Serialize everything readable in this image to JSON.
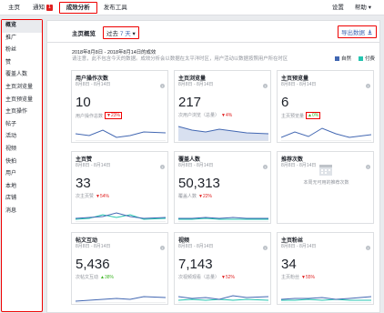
{
  "nav": {
    "tabs": [
      {
        "label": "主页"
      },
      {
        "label": "通知",
        "badge": "1"
      },
      {
        "label": "成效分析"
      },
      {
        "label": "发布工具"
      }
    ],
    "right": [
      {
        "label": "设置"
      },
      {
        "label": "帮助 ▾"
      }
    ]
  },
  "sidebar": {
    "items": [
      {
        "label": "概览"
      },
      {
        "label": "推广"
      },
      {
        "label": "粉丝"
      },
      {
        "label": "赞"
      },
      {
        "label": "覆盖人数"
      },
      {
        "label": "主页浏览量"
      },
      {
        "label": "主页预览量"
      },
      {
        "label": "主页操作"
      },
      {
        "label": "帖子"
      },
      {
        "label": "活动"
      },
      {
        "label": "视频"
      },
      {
        "label": "快拍"
      },
      {
        "label": "用户"
      },
      {
        "label": "本地"
      },
      {
        "label": "店铺"
      },
      {
        "label": "消息"
      }
    ]
  },
  "header": {
    "title": "主页概览",
    "period_prefix": "过去",
    "period_value": "7 天",
    "period_caret": "▾",
    "export_label": "导出数据"
  },
  "daterange": "2018年8月8日 - 2018年8月14日的成效",
  "note": "请注意，此不包含今天的数据。成效分析会以数据在太平洋时区，用户活动以数据按照用户所在时区",
  "legend": [
    {
      "label": "自然",
      "color": "#4267b2"
    },
    {
      "label": "付费",
      "color": "#25c5b0"
    }
  ],
  "cards": [
    {
      "title": "用户操作次数",
      "date": "8月8日 - 8月14日",
      "value": "10",
      "sub": "用户操作总数",
      "change": "▼23%",
      "dir": "down",
      "hl": true
    },
    {
      "title": "主页浏览量",
      "date": "8月8日 - 8月14日",
      "value": "217",
      "sub": "次用户浏览（总量）",
      "change": "▼4%",
      "dir": "down",
      "hl": false
    },
    {
      "title": "主页预览量",
      "date": "8月8日 - 8月14日",
      "value": "6",
      "sub": "主页预览量",
      "change": "▲0%",
      "dir": "up",
      "hl": true
    },
    {
      "title": "主页赞",
      "date": "8月8日 - 8月14日",
      "value": "33",
      "sub": "次主页赞",
      "change": "▼54%",
      "dir": "down",
      "hl": false
    },
    {
      "title": "覆盖人数",
      "date": "8月8日 - 8月14日",
      "value": "50,313",
      "sub": "覆盖人数",
      "change": "▼22%",
      "dir": "down",
      "hl": false
    },
    {
      "title": "推荐次数",
      "date": "8月8日 - 8月14日",
      "value": "",
      "sub": "",
      "change": "",
      "dir": "none",
      "hl": false,
      "nodata": "本周无可用的推荐次数"
    },
    {
      "title": "帖文互动",
      "date": "8月8日 - 8月14日",
      "value": "5,436",
      "sub": "次帖文互动",
      "change": "▲38%",
      "dir": "up",
      "hl": false
    },
    {
      "title": "视频",
      "date": "8月8日 - 8月14日",
      "value": "7,143",
      "sub": "次视频观看（总量）",
      "change": "▼52%",
      "dir": "down",
      "hl": false
    },
    {
      "title": "主页粉丝",
      "date": "8月8日 - 8月14日",
      "value": "34",
      "sub": "主页粉丝",
      "change": "▼55%",
      "dir": "down",
      "hl": false
    }
  ]
}
